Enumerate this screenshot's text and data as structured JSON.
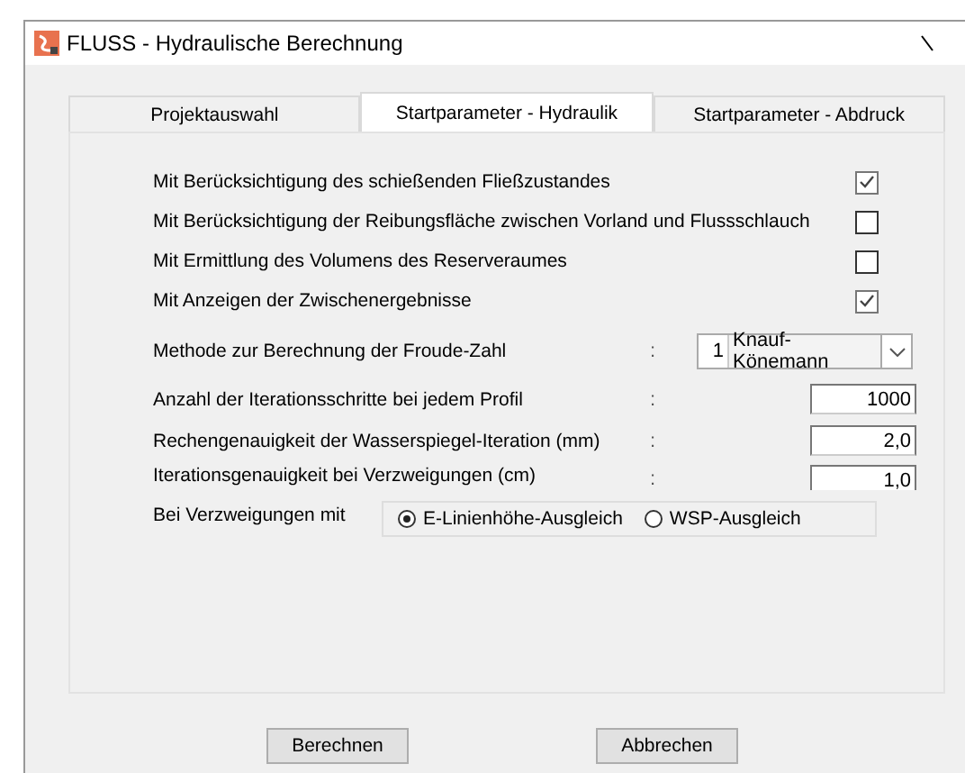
{
  "window": {
    "title": "FLUSS - Hydraulische Berechnung"
  },
  "tabs": [
    {
      "label": "Projektauswahl",
      "selected": false
    },
    {
      "label": "Startparameter - Hydraulik",
      "selected": true
    },
    {
      "label": "Startparameter - Abdruck",
      "selected": false
    }
  ],
  "options": [
    {
      "label": "Mit Berücksichtigung des schießenden Fließzustandes",
      "checked": true
    },
    {
      "label": "Mit Berücksichtigung der Reibungsfläche zwischen Vorland und Flussschlauch",
      "checked": false
    },
    {
      "label": "Mit Ermittlung des Volumens des Reserveraumes",
      "checked": false
    },
    {
      "label": "Mit Anzeigen der Zwischenergebnisse",
      "checked": true
    }
  ],
  "froude": {
    "label": "Methode zur Berechnung der Froude-Zahl",
    "separator": ":",
    "number": "1",
    "value": "Knauf-Könemann"
  },
  "fields": [
    {
      "label": "Anzahl der Iterationsschritte bei jedem Profil",
      "separator": ":",
      "value": "1000"
    },
    {
      "label": "Rechengenauigkeit der Wasserspiegel-Iteration (mm)",
      "separator": ":",
      "value": "2,0"
    },
    {
      "label": "Iterationsgenauigkeit bei Verzweigungen (cm)",
      "separator": ":",
      "value": "1,0"
    }
  ],
  "branching": {
    "label": "Bei Verzweigungen mit",
    "choices": [
      {
        "label": "E-Linienhöhe-Ausgleich",
        "selected": true
      },
      {
        "label": "WSP-Ausgleich",
        "selected": false
      }
    ]
  },
  "buttons": [
    "Berechnen",
    "Abbrechen"
  ]
}
